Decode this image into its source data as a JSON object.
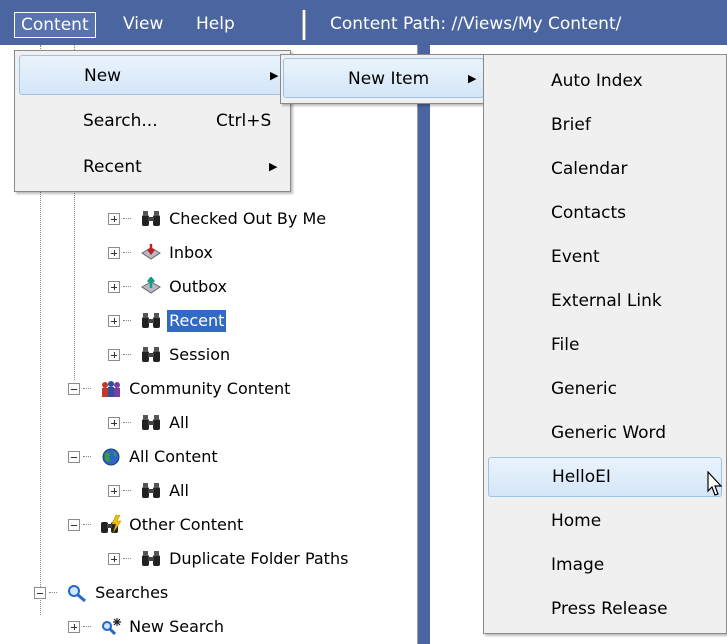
{
  "menubar": {
    "items": [
      "Content",
      "View",
      "Help"
    ],
    "content_path": "Content Path:  //Views/My Content/"
  },
  "menu1": {
    "items": [
      {
        "label": "New",
        "shortcut": "",
        "submenu": true
      },
      {
        "label": "Search...",
        "shortcut": "Ctrl+S",
        "submenu": false
      },
      {
        "label": "Recent",
        "shortcut": "",
        "submenu": true
      }
    ]
  },
  "menu2": {
    "label": "New Item",
    "submenu": true
  },
  "menu3": {
    "items": [
      "Auto Index",
      "Brief",
      "Calendar",
      "Contacts",
      "Event",
      "External Link",
      "File",
      "Generic",
      "Generic Word",
      "HelloEI",
      "Home",
      "Image",
      "Press Release"
    ],
    "highlighted": "HelloEI"
  },
  "tree": {
    "rows": [
      {
        "label": "Checked Out By Me",
        "icon": "binoculars-icon",
        "expander": "plus"
      },
      {
        "label": "Inbox",
        "icon": "inbox-icon",
        "expander": "plus"
      },
      {
        "label": "Outbox",
        "icon": "outbox-icon",
        "expander": "plus"
      },
      {
        "label": "Recent",
        "icon": "binoculars-icon",
        "expander": "plus",
        "selected": true
      },
      {
        "label": "Session",
        "icon": "binoculars-icon",
        "expander": "plus"
      },
      {
        "label": "Community Content",
        "icon": "people-icon",
        "expander": "minus"
      },
      {
        "label": "All",
        "icon": "binoculars-icon",
        "expander": "plus"
      },
      {
        "label": "All Content",
        "icon": "globe-icon",
        "expander": "minus"
      },
      {
        "label": "All",
        "icon": "binoculars-icon",
        "expander": "plus"
      },
      {
        "label": "Other Content",
        "icon": "binoculars-lightning-icon",
        "expander": "minus"
      },
      {
        "label": "Duplicate Folder Paths",
        "icon": "binoculars-icon",
        "expander": "plus"
      },
      {
        "label": "Searches",
        "icon": "magnifier-icon",
        "expander": "minus"
      },
      {
        "label": "New Search",
        "icon": "new-search-icon",
        "expander": "plus"
      }
    ]
  },
  "colors": {
    "menubar": "#4a659f",
    "selection": "#316ac5",
    "menu_bg": "#f0f0f0",
    "hover_border": "#9cc2e8"
  }
}
